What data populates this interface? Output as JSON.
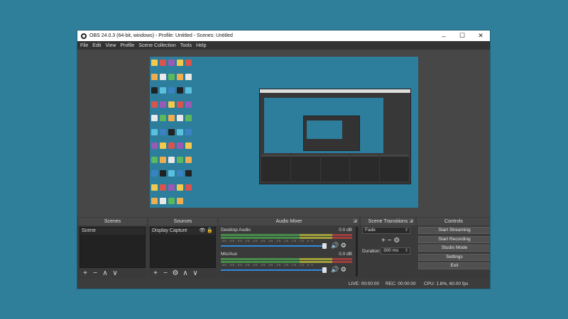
{
  "window": {
    "title": "OBS 24.0.3 (64-bit, windows) - Profile: Untitled - Scenes: Untitled",
    "controls": [
      "–",
      "☐",
      "✕"
    ]
  },
  "menu": [
    "File",
    "Edit",
    "View",
    "Profile",
    "Scene Collection",
    "Tools",
    "Help"
  ],
  "scenes": {
    "title": "Scenes",
    "items": [
      "Scene"
    ],
    "tools": [
      "+",
      "−",
      "∧",
      "∨"
    ]
  },
  "sources": {
    "title": "Sources",
    "items": [
      {
        "label": "Display Capture",
        "visible": true,
        "locked": false
      }
    ],
    "tools": [
      "+",
      "−",
      "⚙",
      "∧",
      "∨"
    ]
  },
  "mixer": {
    "title": "Audio Mixer",
    "tracks": [
      {
        "name": "Desktop Audio",
        "db": "0.0 dB",
        "volume": 1.0,
        "muted": false
      },
      {
        "name": "Mic/Aux",
        "db": "0.0 dB",
        "volume": 1.0,
        "muted": false
      }
    ],
    "tick_labels": "-60 -55 -50 -45 -40 -35 -30 -25 -20 -15 -10 -5 0"
  },
  "transitions": {
    "title": "Scene Transitions",
    "selected": "Fade",
    "duration_label": "Duration",
    "duration_value": "300 ms",
    "tools": [
      "+",
      "−",
      "⚙"
    ]
  },
  "controls": {
    "title": "Controls",
    "buttons": [
      "Start Streaming",
      "Start Recording",
      "Studio Mode",
      "Settings",
      "Exit"
    ]
  },
  "status": {
    "live": "LIVE: 00:00:00",
    "rec": "REC: 00:00:00",
    "cpu": "CPU: 1.8%, 60.00 fps"
  },
  "colors": {
    "desktop_bg": "#2f7f9a",
    "dock_bg": "#3a3a3a",
    "slider": "#2f8ae0"
  }
}
